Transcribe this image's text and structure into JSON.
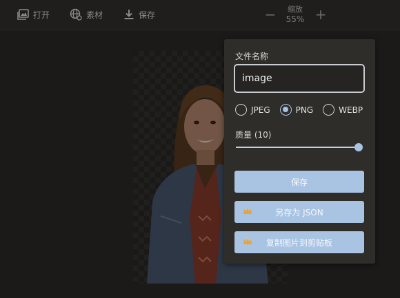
{
  "toolbar": {
    "open_label": "打开",
    "assets_label": "素材",
    "save_label": "保存",
    "zoom_title": "缩放",
    "zoom_value": "55%",
    "zoom_minus": "−",
    "zoom_plus": "+"
  },
  "save_panel": {
    "filename_label": "文件名称",
    "filename_value": "image",
    "formats": [
      {
        "label": "JPEG",
        "checked": false
      },
      {
        "label": "PNG",
        "checked": true
      },
      {
        "label": "WEBP",
        "checked": false
      }
    ],
    "quality_label": "质量 (10)",
    "quality_value": 1.0,
    "save_button": "保存",
    "save_json_button": "另存为 JSON",
    "copy_clipboard_button": "复制图片到剪贴板"
  },
  "colors": {
    "background": "#1b1a18",
    "panel": "#2e2d2a",
    "accent": "#a9c3e3",
    "crown_icon": "#e8a33a"
  },
  "icons": {
    "open": "image-icon",
    "assets": "globe-icon",
    "save": "download-icon",
    "premium": "crown-icon"
  }
}
